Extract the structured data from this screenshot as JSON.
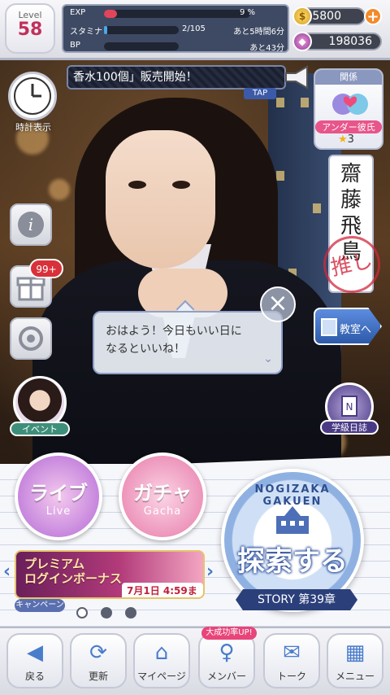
{
  "header": {
    "level_label": "Level",
    "level_value": "58",
    "exp_label": "EXP",
    "exp_value": "9 %",
    "exp_fraction": 0.09,
    "stamina_label": "スタミナ",
    "stamina_value": "2/105",
    "stamina_fraction": 0.02,
    "stamina_timer": "あと5時間6分",
    "bp_label": "BP",
    "bp_timer": "あと43分",
    "gold_value": "5800",
    "gem_value": "198036"
  },
  "ticker": {
    "text": "香水100個」販売開始！",
    "tap_label": "TAP"
  },
  "left_panel": {
    "clock_label": "時計表示",
    "present_count": "99+",
    "event_label": "イベント"
  },
  "right_panel": {
    "relation_header": "関係",
    "relation_title": "アンダー彼氏",
    "relation_stars": "3",
    "name_chars": [
      "齋",
      "藤",
      "飛",
      "鳥"
    ],
    "stamp_text": "推し",
    "classroom_label": "教室へ",
    "diary_label": "学級日誌"
  },
  "speech": {
    "line1": "おはよう！今日もいい日に",
    "line2": "なるといいね！"
  },
  "main_buttons": {
    "live_title": "ライブ",
    "live_sub": "Live",
    "gacha_title": "ガチャ",
    "gacha_sub": "Gacha",
    "explore_arc": "NOGIZAKA GAKUEN",
    "explore_title": "探索する",
    "story_label": "STORY 第39章"
  },
  "campaign": {
    "title_line1": "プレミアム",
    "title_line2": "ログインボーナス",
    "date": "7月1日 4:59まで",
    "tag": "キャンペーン"
  },
  "bottom_nav": {
    "up_badge": "大成功率UP!",
    "items": [
      {
        "label": "戻る",
        "icon": "back-arrow-icon"
      },
      {
        "label": "更新",
        "icon": "refresh-icon"
      },
      {
        "label": "マイページ",
        "icon": "home-icon"
      },
      {
        "label": "メンバー",
        "icon": "member-icon"
      },
      {
        "label": "トーク",
        "icon": "chat-icon"
      },
      {
        "label": "メニュー",
        "icon": "grid-menu-icon"
      }
    ]
  },
  "colors": {
    "accent_blue": "#4a7ccc",
    "level_pink": "#c2305c",
    "badge_red": "#d8313a",
    "exp_fill": "#e0455c",
    "stamina_fill": "#4aa8e8"
  }
}
